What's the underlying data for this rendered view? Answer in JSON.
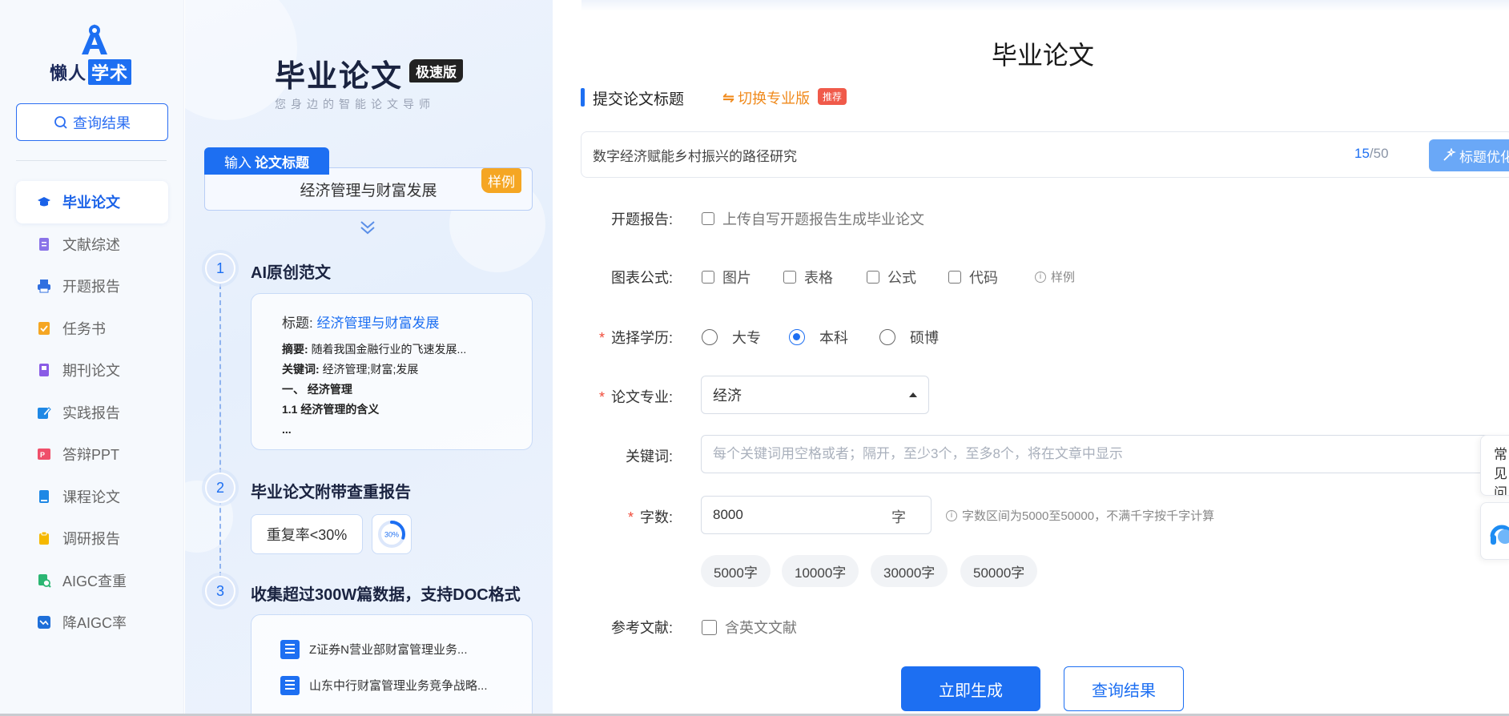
{
  "brand": {
    "name_part1": "懒人",
    "name_part2": "学术"
  },
  "sidebar": {
    "query_button": "查询结果",
    "items": [
      {
        "label": "毕业论文",
        "icon": "graduation-cap-icon",
        "color": "#1a62e8",
        "active": true
      },
      {
        "label": "文献综述",
        "icon": "document-icon",
        "color": "#8a73e8",
        "active": false
      },
      {
        "label": "开题报告",
        "icon": "printer-icon",
        "color": "#2f6fe0",
        "active": false
      },
      {
        "label": "任务书",
        "icon": "edit-list-icon",
        "color": "#f5a623",
        "active": false
      },
      {
        "label": "期刊论文",
        "icon": "book-icon",
        "color": "#8a5ce6",
        "active": false
      },
      {
        "label": "实践报告",
        "icon": "edit-icon",
        "color": "#1e88e5",
        "active": false
      },
      {
        "label": "答辩PPT",
        "icon": "ppt-icon",
        "color": "#ef4f6a",
        "active": false
      },
      {
        "label": "课程论文",
        "icon": "notebook-icon",
        "color": "#1e88e5",
        "active": false
      },
      {
        "label": "调研报告",
        "icon": "clipboard-icon",
        "color": "#f5b800",
        "active": false
      },
      {
        "label": "AIGC查重",
        "icon": "doc-search-icon",
        "color": "#2bb673",
        "active": false
      },
      {
        "label": "降AIGC率",
        "icon": "chart-down-icon",
        "color": "#1e6fd9",
        "active": false
      }
    ]
  },
  "promo": {
    "title": "毕业论文",
    "badge": "极速版",
    "subtitle": "您身边的智能论文导师",
    "input_tag_prefix": "输入",
    "input_tag_bold": "论文标题",
    "input_example": "经济管理与财富发展",
    "sample_tag": "样例",
    "steps": [
      {
        "num": "1",
        "title": "AI原创范文"
      },
      {
        "num": "2",
        "title": "毕业论文附带查重报告"
      },
      {
        "num": "3",
        "title": "收集超过300W篇数据，支持DOC格式"
      }
    ],
    "card1": {
      "title_label": "标题:",
      "title_value": "经济管理与财富发展",
      "abstract_label": "摘要:",
      "abstract_value": "随着我国金融行业的飞速发展...",
      "keywords_label": "关键词:",
      "keywords_value": "经济管理;财富;发展",
      "heading1": "一、 经济管理",
      "heading2": "1.1 经济管理的含义",
      "ellipsis": "..."
    },
    "repeat_rate": "重复率<30%",
    "ring_label": "30%",
    "ring_fraction": 0.3,
    "docs": [
      "Z证券N营业部财富管理业务...",
      "山东中行财富管理业务竞争战略..."
    ],
    "docs_more": "... ..."
  },
  "form": {
    "page_title": "毕业论文",
    "section_title": "提交论文标题",
    "switch_link": "切换专业版",
    "recommend_badge": "推荐",
    "title_value": "数字经济赋能乡村振兴的路径研究",
    "title_count": "15",
    "title_max": "/50",
    "optimize_button": "标题优化",
    "proposal_label": "开题报告:",
    "proposal_checkbox": "上传自写开题报告生成毕业论文",
    "figures_label": "图表公式:",
    "figures_options": [
      "图片",
      "表格",
      "公式",
      "代码"
    ],
    "figures_hint": "样例",
    "degree_label": "选择学历:",
    "degree_options": [
      "大专",
      "本科",
      "硕博"
    ],
    "degree_selected": "本科",
    "major_label": "论文专业:",
    "major_value": "经济",
    "keywords_label": "关键词:",
    "keywords_placeholder": "每个关键词用空格或者；隔开，至少3个，至多8个，将在文章中显示",
    "words_label": "字数:",
    "words_value": "8000",
    "words_unit": "字",
    "words_hint": "字数区间为5000至50000，不满千字按千字计算",
    "word_presets": [
      "5000字",
      "10000字",
      "30000字",
      "50000字"
    ],
    "refs_label": "参考文献:",
    "refs_checkbox": "含英文文献",
    "generate_button": "立即生成",
    "query_button": "查询结果",
    "faq_float": "常见问题"
  },
  "colors": {
    "primary": "#1d6ff2",
    "accent_orange": "#f08a1c",
    "required_star": "#f04b3a"
  }
}
